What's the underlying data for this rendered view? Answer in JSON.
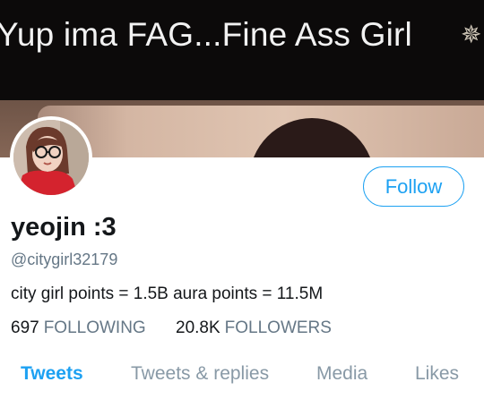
{
  "banner": {
    "caption": "Yup ima FAG...Fine Ass Girl",
    "sparkle": "✵"
  },
  "profile": {
    "display_name": "yeojin :3",
    "handle": "@citygirl32179",
    "bio": "city girl points = 1.5B aura points = 11.5M",
    "follow_label": "Follow",
    "following_count": "697",
    "following_label": "FOLLOWING",
    "followers_count": "20.8K",
    "followers_label": "FOLLOWERS"
  },
  "tabs": [
    {
      "label": "Tweets",
      "active": true
    },
    {
      "label": "Tweets & replies",
      "active": false
    },
    {
      "label": "Media",
      "active": false
    },
    {
      "label": "Likes",
      "active": false
    }
  ],
  "colors": {
    "accent": "#1da1f2",
    "secondary_text": "#657786",
    "inactive_tab": "#8899a6",
    "primary_text": "#14171a"
  }
}
